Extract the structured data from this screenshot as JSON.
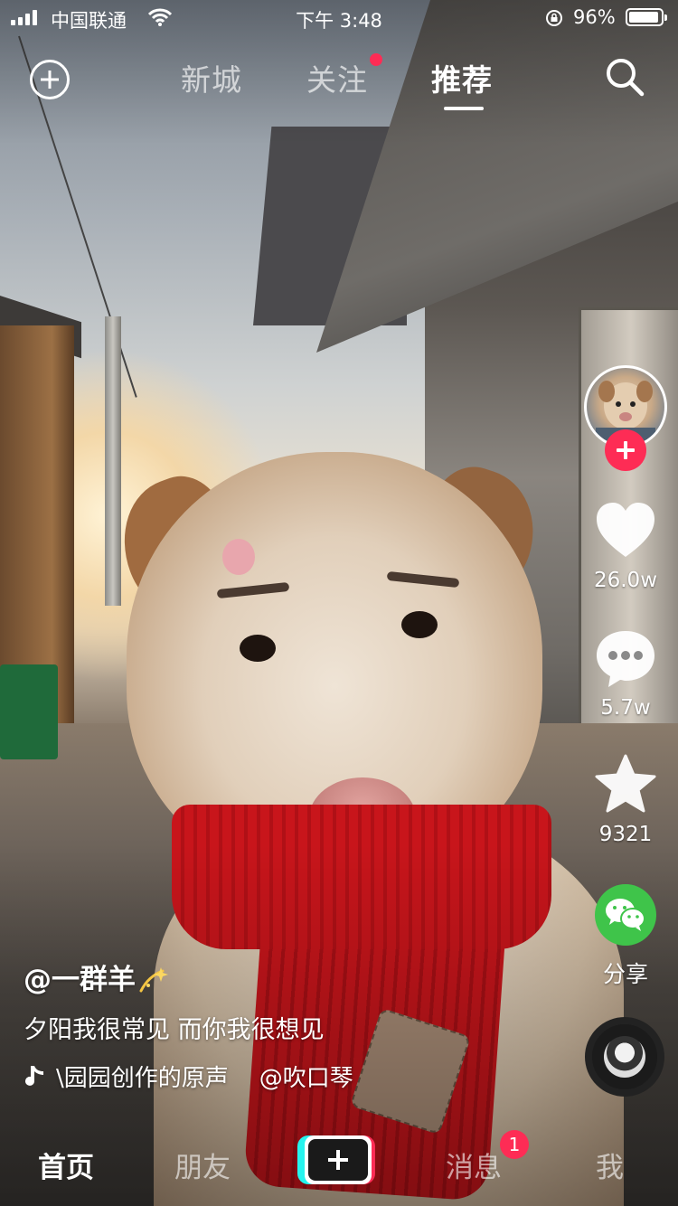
{
  "status_bar": {
    "carrier": "中国联通",
    "time": "下午 3:48",
    "battery_percent": "96%",
    "battery_level": 0.96,
    "signal_bars": 4
  },
  "top_nav": {
    "tabs": [
      {
        "label": "新城",
        "active": false
      },
      {
        "label": "关注",
        "active": false,
        "has_dot": true
      },
      {
        "label": "推荐",
        "active": true
      }
    ],
    "icons": {
      "add": "plus-circle-icon",
      "search": "search-icon"
    }
  },
  "actions": {
    "like_count": "26.0w",
    "comment_count": "5.7w",
    "favorite_count": "9321",
    "share_label": "分享",
    "icons": {
      "follow": "plus-icon",
      "like": "heart-icon",
      "comment": "comment-bubble-icon",
      "favorite": "star-icon",
      "share": "wechat-icon",
      "music": "music-disc-icon"
    }
  },
  "caption": {
    "author": "@一群羊",
    "description": "夕阳我很常见 而你我很想见",
    "music_segments": [
      "\\园园创作的原声",
      "@吹口琴"
    ]
  },
  "bottom_nav": {
    "tabs": [
      {
        "label": "首页",
        "active": true
      },
      {
        "label": "朋友",
        "active": false
      },
      {
        "label": "消息",
        "active": false
      },
      {
        "label": "我",
        "active": false
      }
    ],
    "messages_badge": "1",
    "create_icon": "plus-icon"
  },
  "colors": {
    "accent": "#fe2c55",
    "share_green": "#3fc44a",
    "create_cyan": "#25f4ee"
  }
}
